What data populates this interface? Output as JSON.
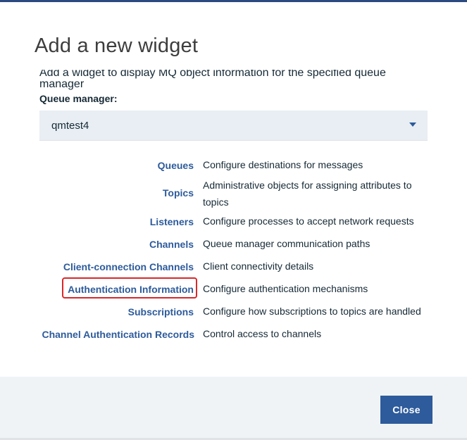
{
  "dialog": {
    "title": "Add a new widget",
    "description": "Add a widget to display MQ object information for the specified queue manager",
    "queue_manager_label": "Queue manager:",
    "queue_manager_value": "qmtest4",
    "close_label": "Close"
  },
  "objects": [
    {
      "label": "Queues",
      "description": "Configure destinations for messages"
    },
    {
      "label": "Topics",
      "description": "Administrative objects for assigning attributes to topics"
    },
    {
      "label": "Listeners",
      "description": "Configure processes to accept network requests"
    },
    {
      "label": "Channels",
      "description": "Queue manager communication paths"
    },
    {
      "label": "Client-connection Channels",
      "description": "Client connectivity details"
    },
    {
      "label": "Authentication Information",
      "description": "Configure authentication mechanisms"
    },
    {
      "label": "Subscriptions",
      "description": "Configure how subscriptions to topics are handled"
    },
    {
      "label": "Channel Authentication Records",
      "description": "Control access to channels"
    }
  ],
  "colors": {
    "accent": "#2d5b9b",
    "highlight": "#d9282b",
    "footer": "#f0f3f6"
  }
}
